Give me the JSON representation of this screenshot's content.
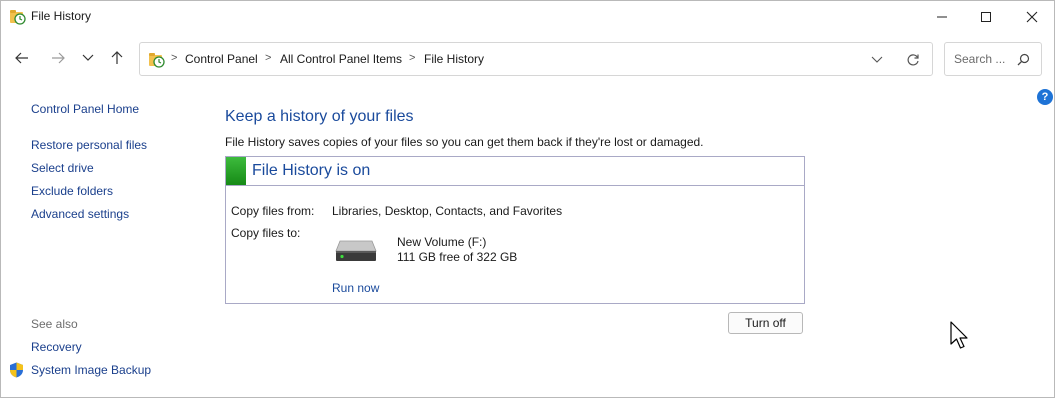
{
  "window": {
    "title": "File History"
  },
  "address": {
    "breadcrumbs": [
      "Control Panel",
      "All Control Panel Items",
      "File History"
    ],
    "separator": ">"
  },
  "search": {
    "placeholder": "Search ..."
  },
  "help_label": "?",
  "sidebar": {
    "home": "Control Panel Home",
    "links": [
      "Restore personal files",
      "Select drive",
      "Exclude folders",
      "Advanced settings"
    ],
    "see_also_label": "See also",
    "see_also": [
      "Recovery",
      "System Image Backup"
    ]
  },
  "main": {
    "heading": "Keep a history of your files",
    "description": "File History saves copies of your files so you can get them back if they're lost or damaged.",
    "status": {
      "text": "File History is on",
      "color": "#22a022"
    },
    "copy_from_label": "Copy files from:",
    "copy_from_value": "Libraries, Desktop, Contacts, and Favorites",
    "copy_to_label": "Copy files to:",
    "drive": {
      "name": "New Volume (F:)",
      "space": "111 GB free of 322 GB",
      "icon": "hard-drive-icon"
    },
    "run_now": "Run now",
    "turn_off": "Turn off"
  },
  "colors": {
    "link": "#1a3f8c",
    "heading": "#1a4a9c",
    "accent": "#1e73d6"
  }
}
